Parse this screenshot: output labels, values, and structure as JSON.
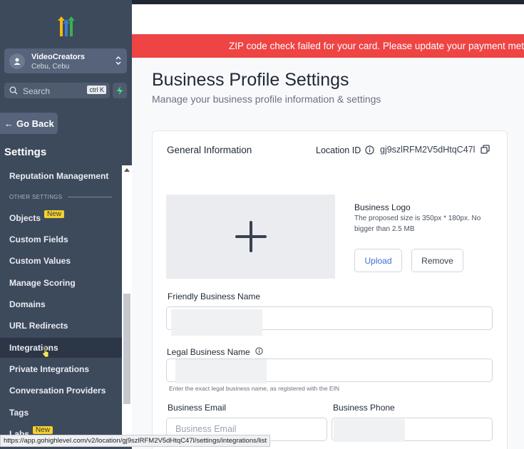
{
  "account": {
    "name": "VideoCreators",
    "location": "Cebu, Cebu"
  },
  "search": {
    "placeholder": "Search",
    "shortcut": "ctrl K"
  },
  "go_back": "Go Back",
  "settings_title": "Settings",
  "nav": {
    "reputation": "Reputation Management",
    "section_other": "OTHER SETTINGS",
    "items": [
      {
        "label": "Objects",
        "badge": "New"
      },
      {
        "label": "Custom Fields"
      },
      {
        "label": "Custom Values"
      },
      {
        "label": "Manage Scoring"
      },
      {
        "label": "Domains"
      },
      {
        "label": "URL Redirects"
      },
      {
        "label": "Integrations"
      },
      {
        "label": "Private Integrations"
      },
      {
        "label": "Conversation Providers"
      },
      {
        "label": "Tags"
      },
      {
        "label": "Labs",
        "badge": "New"
      }
    ]
  },
  "alert": "ZIP code check failed for your card. Please update your payment meth",
  "page": {
    "title": "Business Profile Settings",
    "subtitle": "Manage your business profile information & settings"
  },
  "general": {
    "title": "General Information",
    "location_label": "Location ID",
    "location_id": "gj9szlRFM2V5dHtqC47l"
  },
  "logo": {
    "title": "Business Logo",
    "description": "The proposed size is 350px * 180px. No bigger than 2.5 MB",
    "upload": "Upload",
    "remove": "Remove"
  },
  "fields": {
    "friendly_name": "Friendly Business Name",
    "legal_name": "Legal Business Name",
    "legal_help": "Enter the exact legal business name, as registered with the EIN",
    "email": "Business Email",
    "email_placeholder": "Business Email",
    "phone": "Business Phone"
  },
  "status_url": "https://app.gohighlevel.com/v2/location/gj9szlRFM2V5dHtqC47l/settings/integrations/list",
  "colors": {
    "sidebar": "#3d4a5c",
    "alert": "#ee4444",
    "badge": "#f3d12e",
    "link": "#3b6fd6"
  }
}
